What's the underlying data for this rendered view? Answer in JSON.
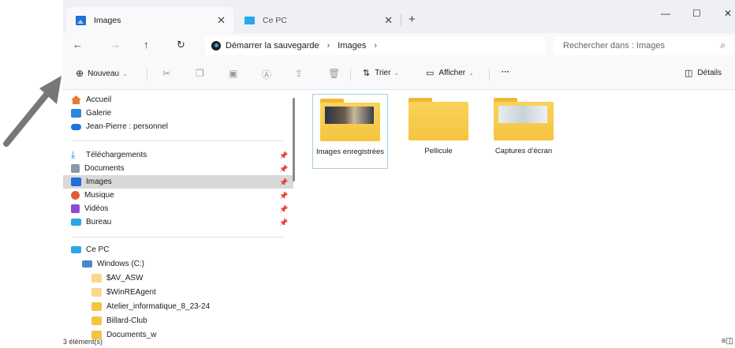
{
  "tabs": [
    {
      "title": "Images",
      "icon": "images-icon"
    },
    {
      "title": "Ce PC",
      "icon": "pc-icon"
    }
  ],
  "window_controls": {
    "minimize": "—",
    "maximize": "☐",
    "close": "✕"
  },
  "address": {
    "segments": [
      "Démarrer la sauvegarde",
      "Images"
    ],
    "search_placeholder": "Rechercher dans : Images"
  },
  "commands": {
    "new_label": "Nouveau",
    "sort_label": "Trier",
    "view_label": "Afficher",
    "more_label": "···",
    "details_label": "Détails"
  },
  "sidebar": {
    "top": [
      "Accueil",
      "Galerie",
      "Jean-Pierre : personnel"
    ],
    "quick": [
      "Téléchargements",
      "Documents",
      "Images",
      "Musique",
      "Vidéos",
      "Bureau"
    ],
    "pc": "Ce PC",
    "drive": "Windows (C:)",
    "folders": [
      "$AV_ASW",
      "$WinREAgent",
      "Atelier_informatique_8_23-24",
      "Billard-Club",
      "Documents_w"
    ]
  },
  "content": {
    "folders": [
      {
        "name": "Images enregistrées"
      },
      {
        "name": "Pellicule"
      },
      {
        "name": "Captures d’écran"
      }
    ]
  },
  "status": {
    "item_count": "3 élément(s)"
  },
  "colors": {
    "accent": "#1f6fd6",
    "folder": "#f5c440",
    "selection": "#d9d9d9"
  }
}
